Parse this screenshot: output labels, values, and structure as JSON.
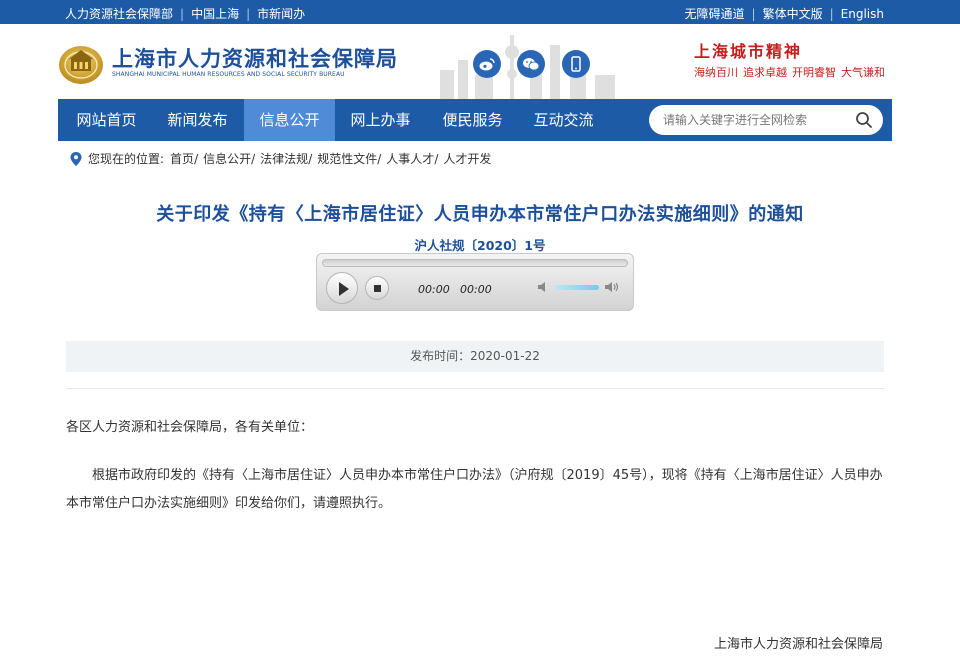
{
  "topbar": {
    "links_left": [
      "人力资源社会保障部",
      "中国上海",
      "市新闻办"
    ],
    "links_right": [
      "无障碍通道",
      "繁体中文版",
      "English"
    ]
  },
  "header": {
    "site_title": "上海市人力资源和社会保障局",
    "site_subtitle": "SHANGHAI MUNICIPAL HUMAN RESOURCES AND SOCIAL SECURITY BUREAU",
    "spirit_title": "上海城市精神",
    "spirit_words": [
      "海纳百川",
      "追求卓越",
      "开明睿智",
      "大气谦和"
    ],
    "social_icons": [
      "weibo-icon",
      "wechat-icon",
      "mobile-icon"
    ]
  },
  "nav": {
    "items": [
      "网站首页",
      "新闻发布",
      "信息公开",
      "网上办事",
      "便民服务",
      "互动交流"
    ],
    "active_index": 2,
    "search_placeholder": "请输入关键字进行全网检索"
  },
  "breadcrumb": {
    "label": "您现在的位置:",
    "items": [
      "首页",
      "信息公开",
      "法律法规",
      "规范性文件",
      "人事人才",
      "人才开发"
    ]
  },
  "article": {
    "title": "关于印发《持有〈上海市居住证〉人员申办本市常住户口办法实施细则》的通知",
    "doc_number": "沪人社规〔2020〕1号",
    "player": {
      "current_time": "00:00",
      "duration": "00:00",
      "progress": 0
    },
    "publish_label": "发布时间：",
    "publish_date": "2020-01-22",
    "salutation": "各区人力资源和社会保障局，各有关单位：",
    "paragraph": "根据市政府印发的《持有〈上海市居住证〉人员申办本市常住户口办法》（沪府规〔2019〕45号），现将《持有〈上海市居住证〉人员申办本市常住户口办法实施细则》印发给你们，请遵照执行。",
    "signature": "上海市人力资源和社会保障局"
  },
  "colors": {
    "primary_blue": "#1d5ba6",
    "nav_active": "#4f8bd6",
    "title_blue": "#1d4f9a",
    "spirit_red": "#c41e1e"
  }
}
